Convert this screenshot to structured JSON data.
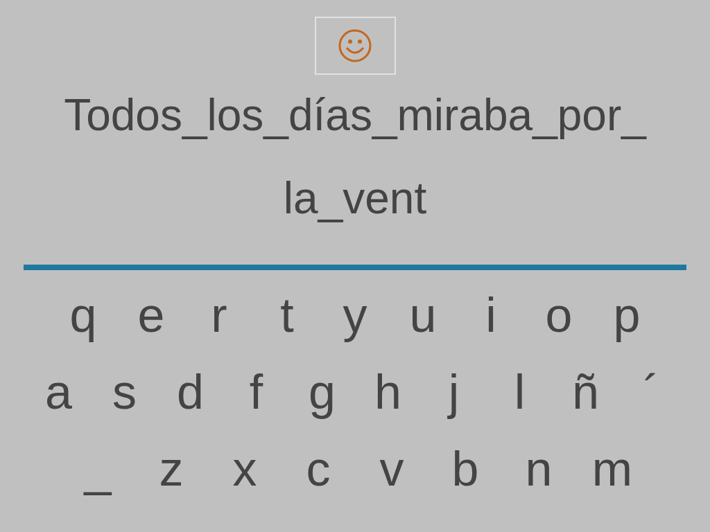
{
  "prompt_lines": [
    "Todos_los_días_miraba_por_",
    "la_vent"
  ],
  "keyboard_rows": [
    [
      "q",
      "e",
      "r",
      "t",
      "y",
      "u",
      "i",
      "o",
      "p"
    ],
    [
      "a",
      "s",
      "d",
      "f",
      "g",
      "h",
      "j",
      "l",
      "ñ",
      "´"
    ],
    [
      "_",
      "z",
      "x",
      "c",
      "v",
      "b",
      "n",
      "m"
    ]
  ]
}
